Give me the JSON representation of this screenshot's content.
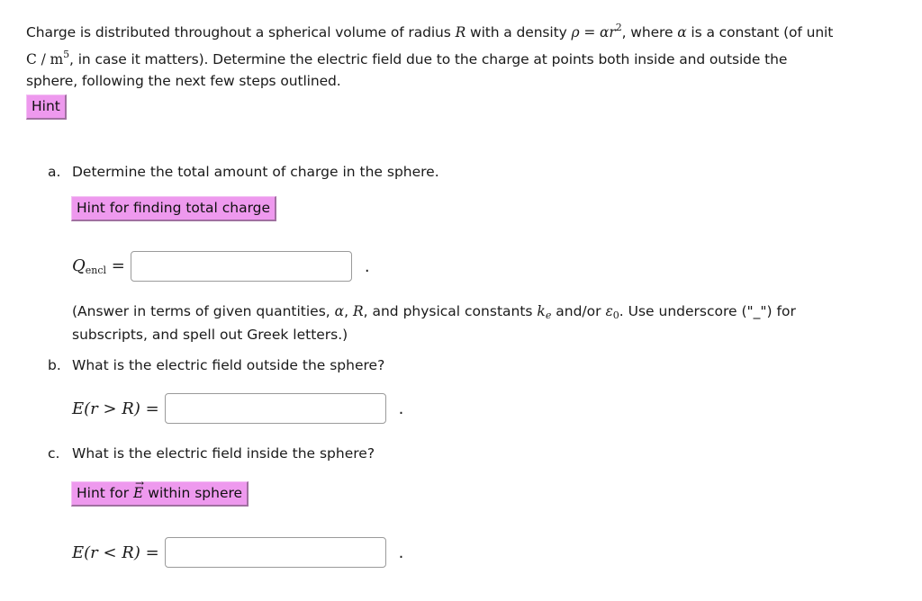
{
  "intro": {
    "t1": "Charge is distributed throughout a spherical volume of radius ",
    "R": "R",
    "t2": " with a density ",
    "rho_eq": "ρ = αr",
    "rho_exp": "2",
    "t3": ", where ",
    "alpha": "α",
    "t4": " is a constant (of unit ",
    "unit": "C / m",
    "unit_exp": "5",
    "t5": ", in case it matters). Determine the electric field due to the charge at points both inside and outside the sphere, following the next few steps outlined."
  },
  "hint_main": "Hint",
  "parts": [
    {
      "label": "a.",
      "question": "Determine the total amount of charge in the sphere.",
      "hint": "Hint for finding total charge",
      "lhs_var": "Q",
      "lhs_sub": "encl",
      "lhs_rest": " =",
      "value": "",
      "placeholder": ""
    },
    {
      "label": "b.",
      "question": "What is the electric field outside the sphere?",
      "lhs": "E(r > R) =",
      "value": "",
      "placeholder": ""
    },
    {
      "label": "c.",
      "question": "What is the electric field inside the sphere?",
      "hint_pre": "Hint for ",
      "hint_vec": "E",
      "hint_post": " within sphere",
      "lhs": "E(r < R) =",
      "value": "",
      "placeholder": ""
    }
  ],
  "note": {
    "t1": "(Answer in terms of given quantities, ",
    "alpha": "α",
    "t2": ", ",
    "R": "R",
    "t3": ", and physical constants ",
    "k": "k",
    "k_sub": "e",
    "t4": " and/or ",
    "eps": "ε",
    "eps_sub": "0",
    "t5": ". Use underscore (\"_\") for subscripts, and spell out Greek letters.)"
  },
  "period": "."
}
